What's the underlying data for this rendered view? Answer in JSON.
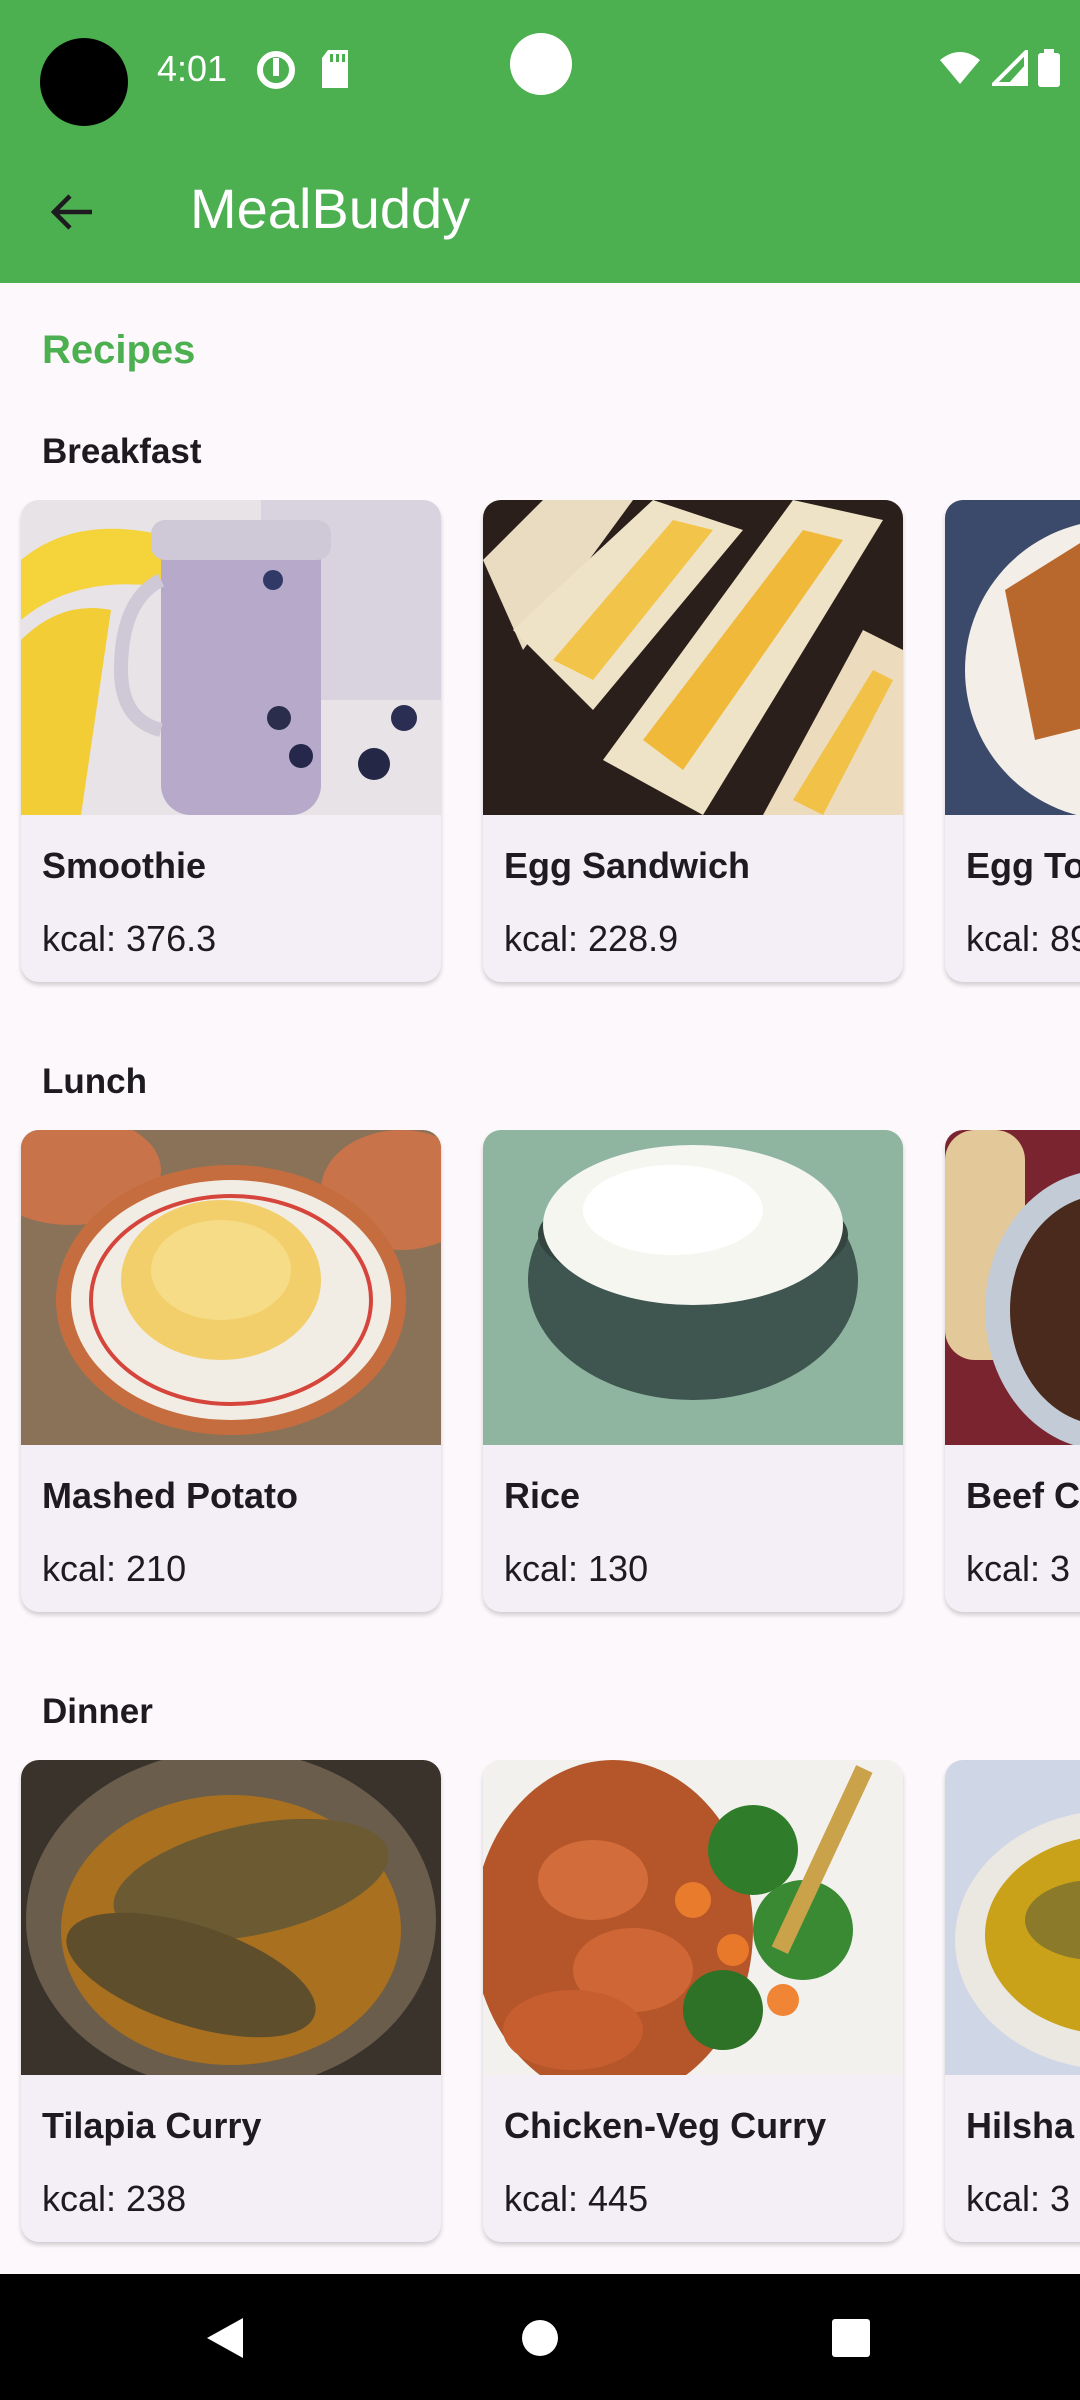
{
  "status_bar": {
    "time": "4:01"
  },
  "app_bar": {
    "title": "MealBuddy"
  },
  "section_title": "Recipes",
  "groups": [
    {
      "label": "Breakfast",
      "items": [
        {
          "name": "Smoothie",
          "kcal": "kcal: 376.3"
        },
        {
          "name": "Egg Sandwich",
          "kcal": "kcal: 228.9"
        },
        {
          "name": "Egg To",
          "kcal": "kcal: 89"
        }
      ]
    },
    {
      "label": "Lunch",
      "items": [
        {
          "name": "Mashed Potato",
          "kcal": "kcal: 210"
        },
        {
          "name": "Rice",
          "kcal": "kcal: 130"
        },
        {
          "name": "Beef C",
          "kcal": "kcal: 3"
        }
      ]
    },
    {
      "label": "Dinner",
      "items": [
        {
          "name": "Tilapia Curry",
          "kcal": "kcal: 238"
        },
        {
          "name": "Chicken-Veg Curry",
          "kcal": "kcal: 445"
        },
        {
          "name": "Hilsha",
          "kcal": "kcal: 3"
        }
      ]
    }
  ],
  "colors": {
    "primary": "#4caf50",
    "background": "#fdf8fc",
    "card": "#f4eff6"
  },
  "icons": {
    "back": "arrow-back-icon",
    "nav_back": "triangle-back-icon",
    "nav_home": "circle-home-icon",
    "nav_recents": "square-recents-icon"
  }
}
